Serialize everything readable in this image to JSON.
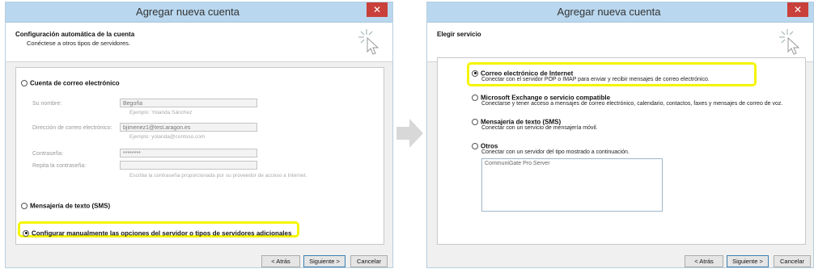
{
  "left_window": {
    "title": "Agregar nueva cuenta",
    "close_icon": "close-icon",
    "header_title": "Configuración automática de la cuenta",
    "header_subtitle": "Conéctese a otros tipos de servidores.",
    "options": {
      "email": "Cuenta de correo electrónico",
      "sms": "Mensajería de texto (SMS)",
      "manual": "Configurar manualmente las opciones del servidor o tipos de servidores adicionales"
    },
    "fields": {
      "name_label": "Su nombre:",
      "name_value": "Begoña",
      "name_hint": "Ejemplo: Yolanda Sánchez",
      "email_label": "Dirección de correo electrónico:",
      "email_value": "bjimenez1@test.aragon.es",
      "email_hint": "Ejemplo: yolanda@contoso.com",
      "password_label": "Contraseña:",
      "password_value": "********",
      "repeat_label": "Repita la contraseña:",
      "password_hint": "Escriba la contraseña proporcionada por su proveedor de acceso a Internet."
    },
    "buttons": {
      "back": "< Atrás",
      "next": "Siguiente >",
      "cancel": "Cancelar"
    }
  },
  "right_window": {
    "title": "Agregar nueva cuenta",
    "close_icon": "close-icon",
    "header_title": "Elegir servicio",
    "options": [
      {
        "label": "Correo electrónico de Internet",
        "desc": "Conectar con el servidor POP o IMAP para enviar y recibir mensajes de correo electrónico.",
        "selected": true
      },
      {
        "label": "Microsoft Exchange o servicio compatible",
        "desc": "Conectarse y tener acceso a mensajes de correo electrónico, calendario, contactos, faxes y mensajes de correo de voz.",
        "selected": false
      },
      {
        "label": "Mensajería de texto (SMS)",
        "desc": "Conectar con un servicio de mensajería móvil.",
        "selected": false
      },
      {
        "label": "Otros",
        "desc": "Conectar con un servidor del tipo mostrado a continuación.",
        "selected": false
      }
    ],
    "other_list_item": "CommuniGate Pro Server",
    "buttons": {
      "back": "< Atrás",
      "next": "Siguiente >",
      "cancel": "Cancelar"
    }
  },
  "colors": {
    "highlight": "#f5f500",
    "titlebar": "#b9d7ee",
    "close": "#c9403a"
  }
}
